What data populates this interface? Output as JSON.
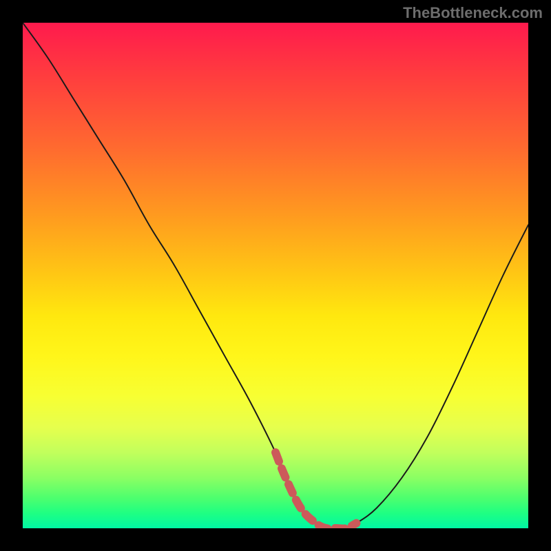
{
  "watermark": "TheBottleneck.com",
  "chart_data": {
    "type": "line",
    "title": "",
    "xlabel": "",
    "ylabel": "",
    "xlim": [
      0,
      100
    ],
    "ylim": [
      0,
      100
    ],
    "grid": false,
    "series": [
      {
        "name": "curve",
        "x": [
          0,
          5,
          10,
          15,
          20,
          25,
          30,
          35,
          40,
          45,
          50,
          52,
          55,
          58,
          60,
          62,
          64,
          66,
          70,
          75,
          80,
          85,
          90,
          95,
          100
        ],
        "y": [
          100,
          93,
          85,
          77,
          69,
          60,
          52,
          43,
          34,
          25,
          15,
          10,
          4,
          1,
          0,
          0,
          0,
          1,
          4,
          10,
          18,
          28,
          39,
          50,
          60
        ]
      }
    ],
    "highlight": {
      "name": "flat-region",
      "x": [
        50,
        52,
        55,
        58,
        60,
        62,
        64,
        66
      ],
      "y": [
        15,
        10,
        4,
        1,
        0,
        0,
        0,
        1
      ],
      "stroke": "#cc5a5a",
      "stroke_width": 12,
      "dash": [
        14,
        11
      ]
    },
    "colors": {
      "curve": "#1a1a1a",
      "gradient_top": "#ff1a4d",
      "gradient_mid": "#fff61a",
      "gradient_bottom": "#00f7a4",
      "frame_border": "#000000"
    }
  }
}
